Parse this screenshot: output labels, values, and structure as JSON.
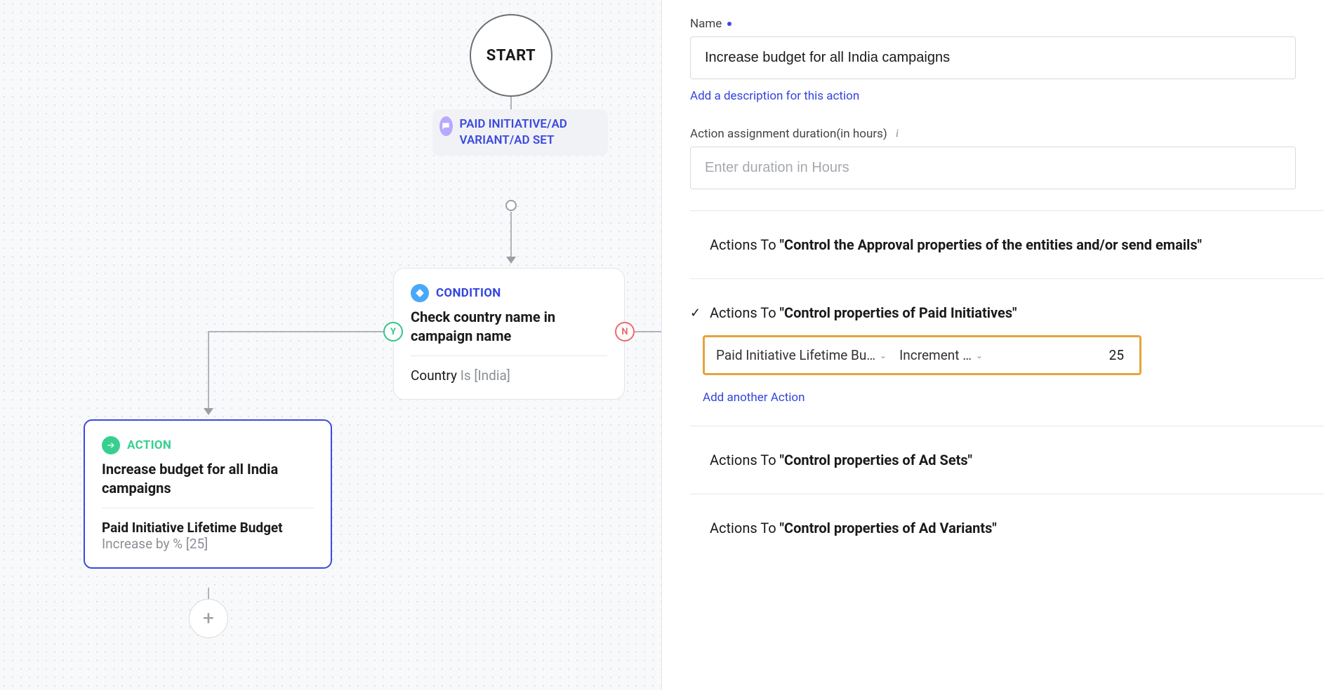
{
  "canvas": {
    "start_label": "START",
    "tag_label": "PAID INITIATIVE/AD VARIANT/AD SET",
    "yes_label": "Y",
    "no_label": "N",
    "condition": {
      "type_label": "CONDITION",
      "title": "Check country name in campaign name",
      "field": "Country",
      "op": "Is",
      "value": "[India]"
    },
    "action": {
      "type_label": "ACTION",
      "title": "Increase budget for all India campaigns",
      "detail_bold": "Paid Initiative Lifetime Budget",
      "detail_rest": "Increase by % [25]"
    }
  },
  "panel": {
    "name_label": "Name",
    "name_value": "Increase budget for all India campaigns",
    "add_description": "Add a description for this action",
    "duration_label": "Action assignment duration(in hours)",
    "duration_placeholder": "Enter duration in Hours",
    "sections": {
      "approval": {
        "prefix": "Actions To ",
        "bold": "\"Control the Approval properties of the entities and/or send emails\""
      },
      "paid_init": {
        "prefix": "Actions To ",
        "bold": "\"Control properties of Paid Initiatives\""
      },
      "ad_sets": {
        "prefix": "Actions To ",
        "bold": "\"Control properties of Ad Sets\""
      },
      "ad_variants": {
        "prefix": "Actions To ",
        "bold": "\"Control properties of Ad Variants\""
      }
    },
    "editor": {
      "property": "Paid Initiative Lifetime Bu…",
      "operation": "Increment …",
      "value": "25"
    },
    "add_action": "Add another Action"
  }
}
